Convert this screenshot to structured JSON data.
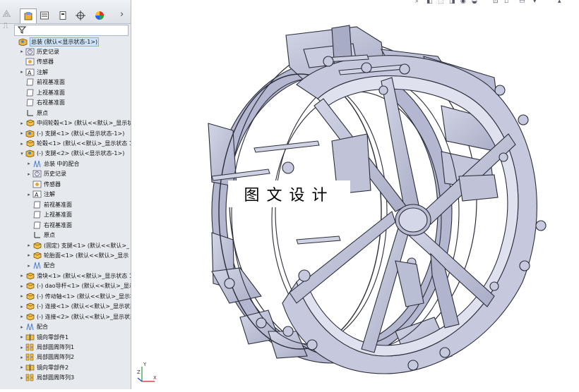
{
  "toolbar": {
    "tabs": [
      {
        "name": "feature-manager-tab",
        "icon": "feature-manager-icon"
      },
      {
        "name": "property-manager-tab",
        "icon": "property-manager-icon"
      },
      {
        "name": "configuration-manager-tab",
        "icon": "configuration-manager-icon"
      },
      {
        "name": "dimxpert-tab",
        "icon": "crosshair-icon"
      },
      {
        "name": "display-manager-tab",
        "icon": "appearance-pie-icon"
      }
    ],
    "more_glyph": "›",
    "filter_glyph": "▼"
  },
  "tree": [
    {
      "label": "总装 (默认<显示状态-1>)",
      "indent": 0,
      "toggle": "",
      "icon": "assembly",
      "selected": true
    },
    {
      "label": "历史记录",
      "indent": 1,
      "toggle": "▸",
      "icon": "history"
    },
    {
      "label": "传感器",
      "indent": 1,
      "toggle": "",
      "icon": "sensor"
    },
    {
      "label": "注解",
      "indent": 1,
      "toggle": "▸",
      "icon": "annotation"
    },
    {
      "label": "前视基准面",
      "indent": 1,
      "toggle": "",
      "icon": "plane"
    },
    {
      "label": "上视基准面",
      "indent": 1,
      "toggle": "",
      "icon": "plane"
    },
    {
      "label": "右视基准面",
      "indent": 1,
      "toggle": "",
      "icon": "plane"
    },
    {
      "label": "原点",
      "indent": 1,
      "toggle": "",
      "icon": "origin"
    },
    {
      "label": "中间轮毂<1> (默认<<默认>_显示状",
      "indent": 1,
      "toggle": "▸",
      "icon": "part"
    },
    {
      "label": "(-) 支腿<1> (默认<显示状态-1>)",
      "indent": 1,
      "toggle": "▸",
      "icon": "subasm"
    },
    {
      "label": "轮毂<1> (默认<<默认>_显示状态 1",
      "indent": 1,
      "toggle": "▸",
      "icon": "part"
    },
    {
      "label": "(-) 支腿<2> (默认<显示状态-1>)",
      "indent": 1,
      "toggle": "▾",
      "icon": "subasm"
    },
    {
      "label": "总装 中的配合",
      "indent": 2,
      "toggle": "▸",
      "icon": "mates"
    },
    {
      "label": "历史记录",
      "indent": 2,
      "toggle": "▸",
      "icon": "history"
    },
    {
      "label": "传感器",
      "indent": 2,
      "toggle": "",
      "icon": "sensor"
    },
    {
      "label": "注解",
      "indent": 2,
      "toggle": "▸",
      "icon": "annotation"
    },
    {
      "label": "前视基准面",
      "indent": 2,
      "toggle": "",
      "icon": "plane"
    },
    {
      "label": "上视基准面",
      "indent": 2,
      "toggle": "",
      "icon": "plane"
    },
    {
      "label": "右视基准面",
      "indent": 2,
      "toggle": "",
      "icon": "plane"
    },
    {
      "label": "原点",
      "indent": 2,
      "toggle": "",
      "icon": "origin"
    },
    {
      "label": "(固定) 支腿<1> (默认<<默认>_",
      "indent": 2,
      "toggle": "▸",
      "icon": "part"
    },
    {
      "label": "轮胎面<1> (默认<<默认>_显示",
      "indent": 2,
      "toggle": "▸",
      "icon": "part"
    },
    {
      "label": "配合",
      "indent": 2,
      "toggle": "▸",
      "icon": "mates"
    },
    {
      "label": "滑块<1> (默认<<默认>_显示状态 1",
      "indent": 1,
      "toggle": "▸",
      "icon": "part"
    },
    {
      "label": "(-) dao导杆<1> (默认<<默认>_显示",
      "indent": 1,
      "toggle": "▸",
      "icon": "part"
    },
    {
      "label": "(-) 传动轴<1> (默认<<默认>_显示状",
      "indent": 1,
      "toggle": "▸",
      "icon": "part"
    },
    {
      "label": "(-) 连接<1> (默认<<默认>_显示状态",
      "indent": 1,
      "toggle": "▸",
      "icon": "part"
    },
    {
      "label": "(-) 连接<2> (默认<<默认>_显示状态",
      "indent": 1,
      "toggle": "▸",
      "icon": "part"
    },
    {
      "label": "配合",
      "indent": 1,
      "toggle": "▸",
      "icon": "mates"
    },
    {
      "label": "镜向零部件1",
      "indent": 1,
      "toggle": "▸",
      "icon": "mirror"
    },
    {
      "label": "局部圆周阵列1",
      "indent": 1,
      "toggle": "▸",
      "icon": "pattern"
    },
    {
      "label": "局部圆周阵列2",
      "indent": 1,
      "toggle": "▸",
      "icon": "pattern"
    },
    {
      "label": "镜向零部件2",
      "indent": 1,
      "toggle": "▸",
      "icon": "mirror"
    },
    {
      "label": "局部圆周阵列3",
      "indent": 1,
      "toggle": "▸",
      "icon": "pattern"
    }
  ],
  "watermark": "图文设计",
  "triad": {
    "z": "Z",
    "x": "X",
    "y": "Y"
  },
  "colors": {
    "panel": "#e6e9ee",
    "model": "#bfc3d9",
    "model_dark": "#9ea3bd",
    "edge": "#2b2d3a"
  }
}
